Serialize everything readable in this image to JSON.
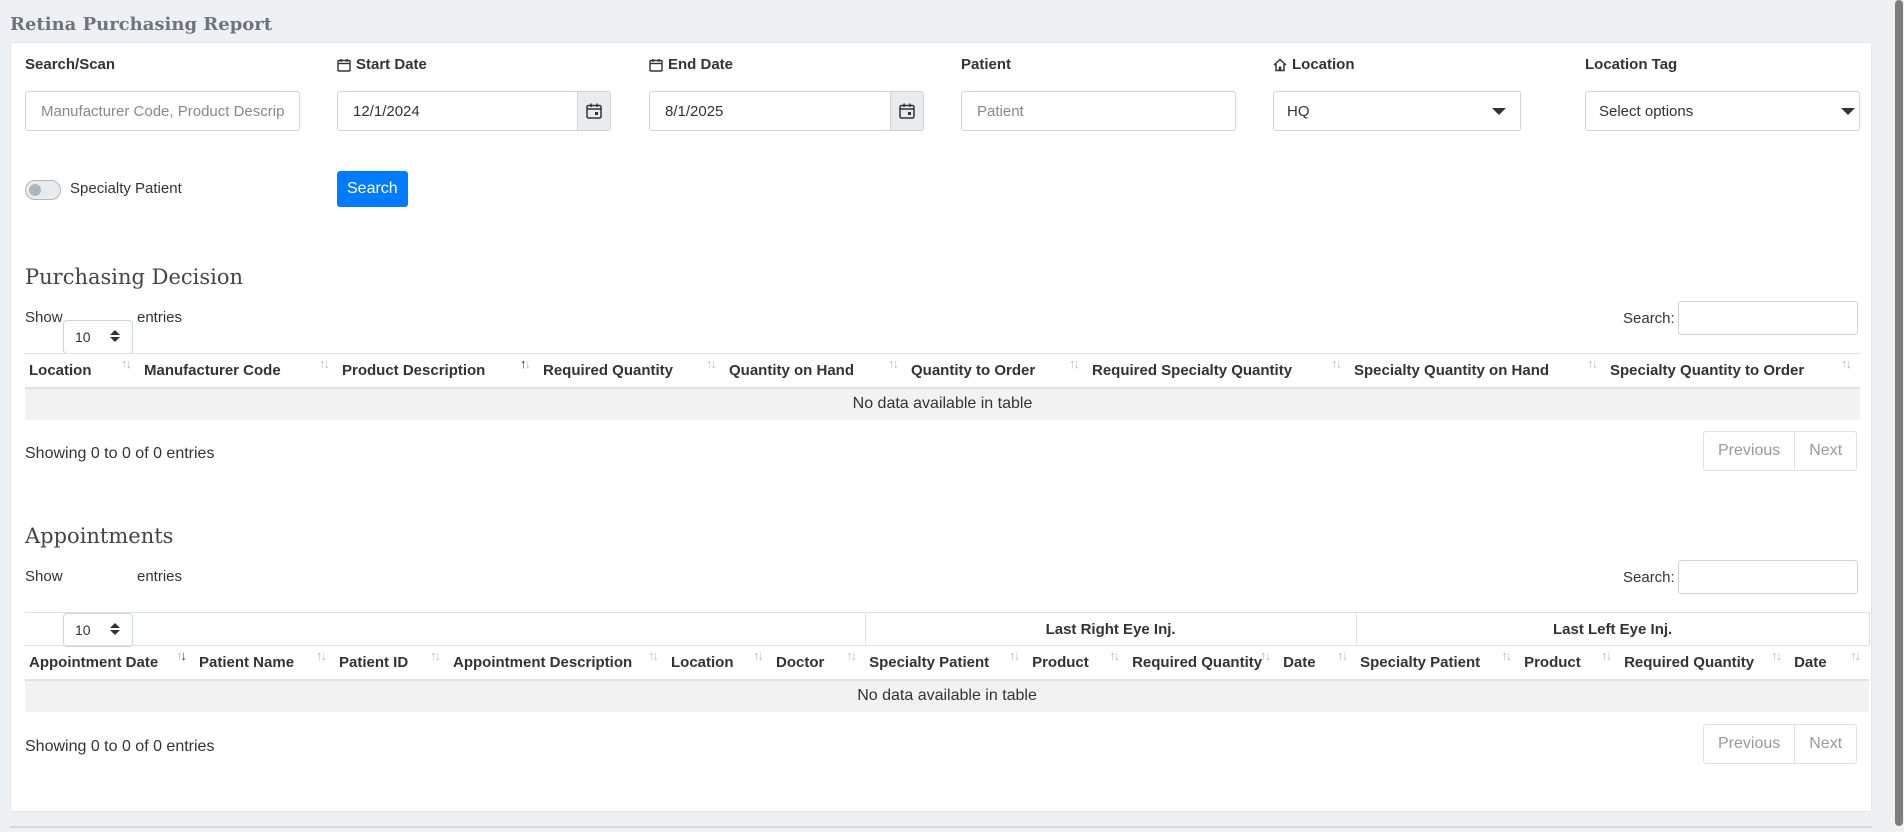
{
  "page": {
    "title": "Retina Purchasing Report"
  },
  "filters": {
    "search_label": "Search/Scan",
    "search_placeholder": "Manufacturer Code, Product Description",
    "start_date_label": "Start Date",
    "start_date_value": "12/1/2024",
    "end_date_label": "End Date",
    "end_date_value": "8/1/2025",
    "patient_label": "Patient",
    "patient_placeholder": "Patient",
    "location_label": "Location",
    "location_value": "HQ",
    "location_tag_label": "Location Tag",
    "location_tag_value": "Select options",
    "specialty_toggle_label": "Specialty Patient",
    "search_button": "Search"
  },
  "purchasing": {
    "title": "Purchasing Decision",
    "show_label": "Show",
    "entries_value": "10",
    "entries_label": "entries",
    "search_label": "Search:",
    "columns": [
      "Location",
      "Manufacturer Code",
      "Product Description",
      "Required Quantity",
      "Quantity on Hand",
      "Quantity to Order",
      "Required Specialty Quantity",
      "Specialty Quantity on Hand",
      "Specialty Quantity to Order"
    ],
    "empty_text": "No data available in table",
    "info": "Showing 0 to 0 of 0 entries",
    "prev": "Previous",
    "next": "Next"
  },
  "appointments": {
    "title": "Appointments",
    "show_label": "Show",
    "entries_value": "10",
    "entries_label": "entries",
    "search_label": "Search:",
    "group_right": "Last Right Eye Inj.",
    "group_left": "Last Left Eye Inj.",
    "columns": [
      "Appointment Date",
      "Patient Name",
      "Patient ID",
      "Appointment Description",
      "Location",
      "Doctor",
      "Specialty Patient",
      "Product",
      "Required Quantity",
      "Date",
      "Specialty Patient",
      "Product",
      "Required Quantity",
      "Date"
    ],
    "empty_text": "No data available in table",
    "info": "Showing 0 to 0 of 0 entries",
    "prev": "Previous",
    "next": "Next"
  }
}
